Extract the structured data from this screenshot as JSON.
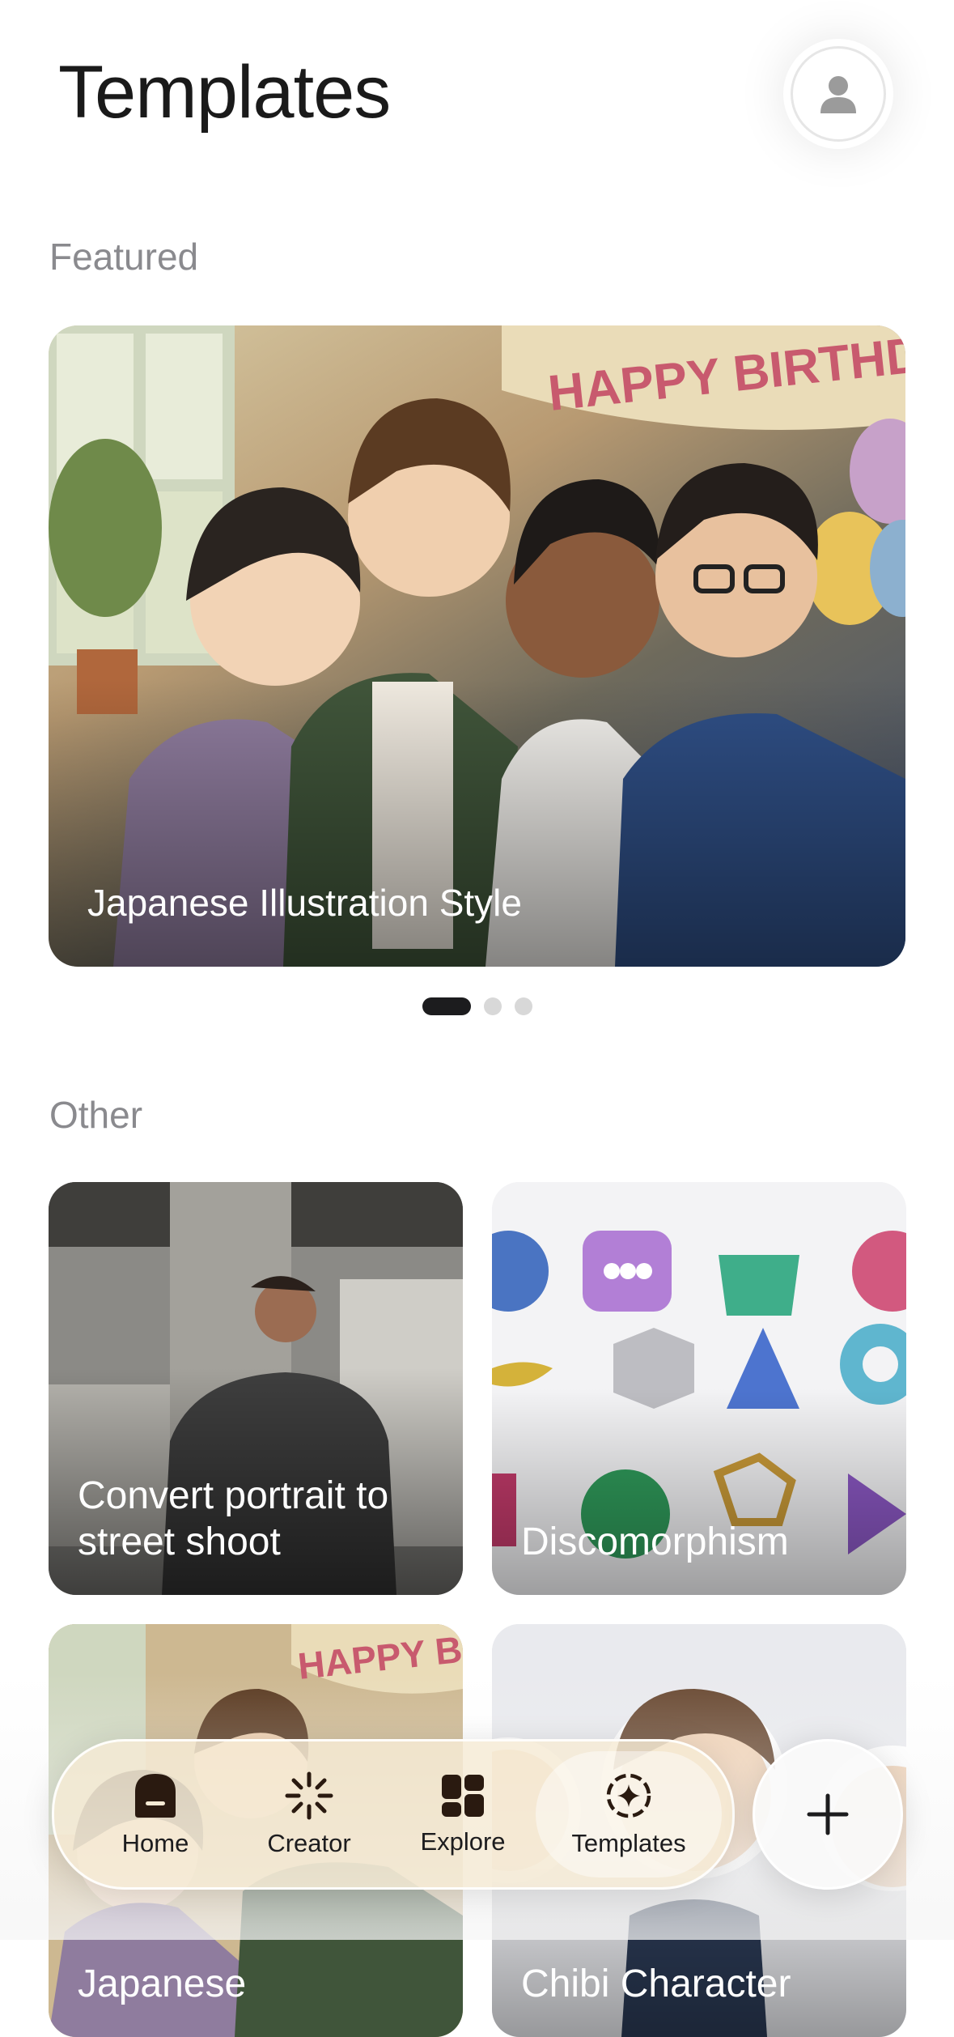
{
  "header": {
    "title": "Templates"
  },
  "sections": {
    "featured_label": "Featured",
    "other_label": "Other"
  },
  "featured": {
    "caption": "Japanese Illustration Style",
    "banner_text": "HAPPY BIRTHDAY!",
    "carousel_pages": 3,
    "carousel_active_index": 0
  },
  "tiles": [
    {
      "caption": "Convert portrait to street shoot"
    },
    {
      "caption": "Discomorphism"
    },
    {
      "caption": "Japanese",
      "banner_text": "HAPPY BIRTHDA"
    },
    {
      "caption": "Chibi Character"
    }
  ],
  "tabbar": {
    "items": [
      {
        "label": "Home",
        "icon": "home-icon"
      },
      {
        "label": "Creator",
        "icon": "sparkle-burst-icon"
      },
      {
        "label": "Explore",
        "icon": "grid-icon"
      },
      {
        "label": "Templates",
        "icon": "sparkle-circle-icon"
      }
    ],
    "selected": "Templates"
  },
  "colors": {
    "accent": "#1c1c1e",
    "tabbar_bg": "#f5ead4",
    "secondary_text": "#8a8a8e"
  }
}
